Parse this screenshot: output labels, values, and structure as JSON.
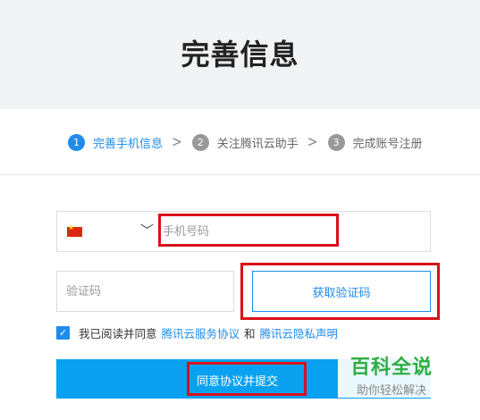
{
  "page": {
    "title": "完善信息"
  },
  "steps": [
    {
      "number": "1",
      "label": "完善手机信息",
      "state": "active"
    },
    {
      "number": "2",
      "label": "关注腾讯云助手",
      "state": "inactive"
    },
    {
      "number": "3",
      "label": "完成账号注册",
      "state": "inactive"
    }
  ],
  "form": {
    "country_flag": "cn-flag-icon",
    "phone_placeholder": "手机号码",
    "code_placeholder": "验证码",
    "get_code_label": "获取验证码",
    "agree_prefix": "我已阅读并同意",
    "service_agreement": "腾讯云服务协议",
    "and_text": "和",
    "privacy_statement": "腾讯云隐私声明",
    "agreed": true,
    "submit_label": "同意协议并提交"
  },
  "watermark": {
    "title": "百科全说",
    "subtitle": "助你轻松解决"
  },
  "colors": {
    "accent": "#1f8ceb",
    "submit": "#0aa2f0",
    "highlight": "#d9101a",
    "watermark": "#2fae42"
  }
}
